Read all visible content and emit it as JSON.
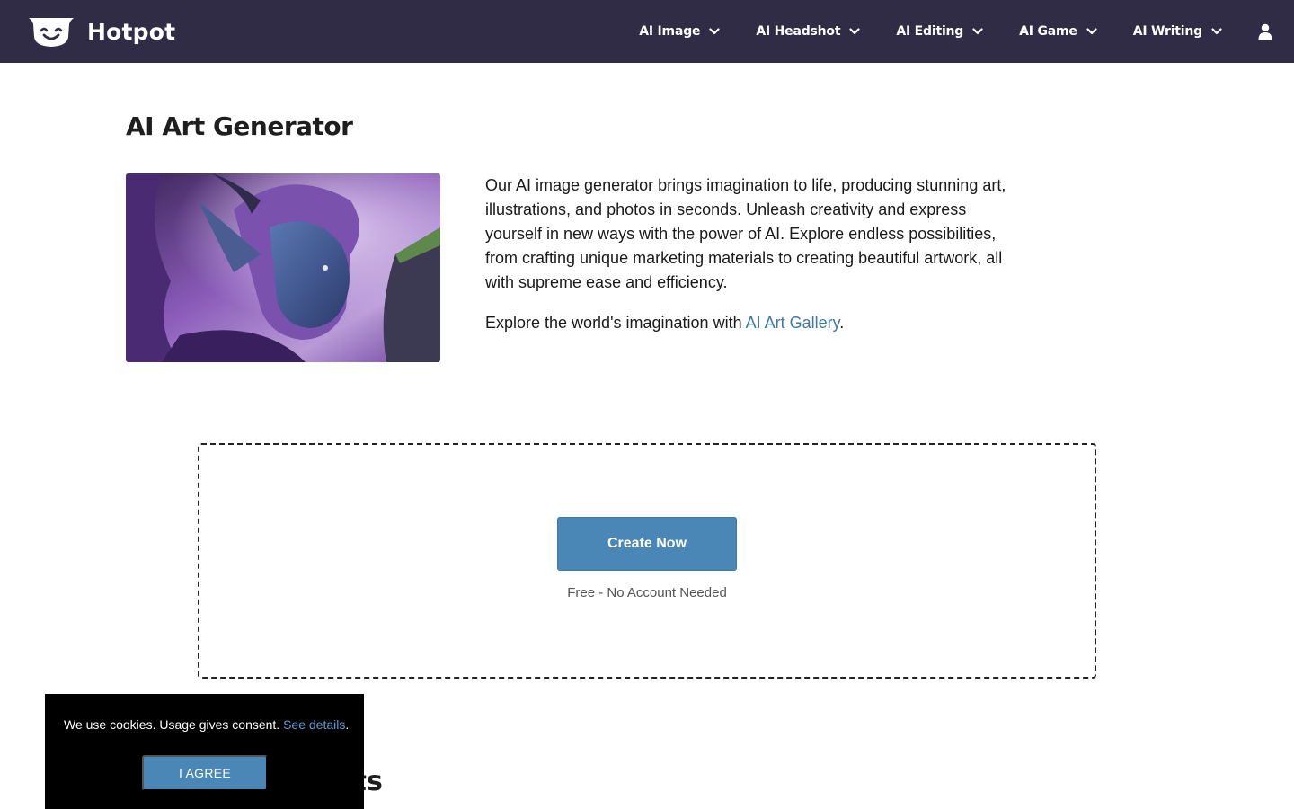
{
  "header": {
    "brand": "Hotpot",
    "nav": [
      {
        "label": "AI Image",
        "icon": "chevron-down-icon"
      },
      {
        "label": "AI Headshot",
        "icon": "chevron-down-icon"
      },
      {
        "label": "AI Editing",
        "icon": "chevron-down-icon"
      },
      {
        "label": "AI Game",
        "icon": "chevron-down-icon"
      },
      {
        "label": "AI Writing",
        "icon": "chevron-down-icon"
      }
    ],
    "account_icon": "user-icon",
    "background": "#302c46"
  },
  "intro": {
    "title": "AI Art Generator",
    "image": "fantasy-elf-portrait-illustration",
    "description": "Our AI image generator brings imagination to life, producing stunning art, illustrations, and photos in seconds. Unleash creativity and express yourself in new ways with the power of AI. Explore endless possibilities, from crafting unique marketing materials to creating beautiful artwork, all with supreme ease and efficiency.",
    "gallery_prefix": "Explore the world's imagination with ",
    "gallery_link": "AI Art Gallery",
    "gallery_suffix": "."
  },
  "create": {
    "button_label": "Create Now",
    "subtext": "Free - No Account Needed",
    "accent": "#4a87b7"
  },
  "next_section": {
    "heading_visible": "ots"
  },
  "cookie_banner": {
    "text": "We use cookies. Usage gives consent. ",
    "link": "See details",
    "suffix": ".",
    "button_label": "I AGREE"
  }
}
